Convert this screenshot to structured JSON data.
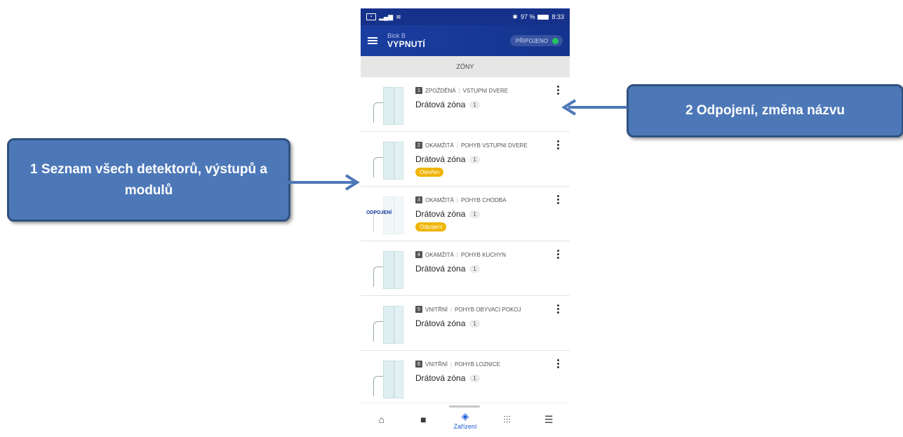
{
  "statusbar": {
    "left": "… ≡",
    "right": "97 %",
    "time": "8:33"
  },
  "appbar": {
    "subtitle": "Blok B",
    "title": "VYPNUTÍ",
    "connection": "PŘIPOJENO"
  },
  "section_title": "ZÓNY",
  "zones": [
    {
      "num": "1",
      "type": "ZPOŽDĚNÁ",
      "name": "VSTUPNI DVERE",
      "label": "Drátová zóna",
      "count": "1",
      "state": ""
    },
    {
      "num": "2",
      "type": "OKAMŽITÁ",
      "name": "POHYB VSTUPNI DVERE",
      "label": "Drátová zóna",
      "count": "1",
      "state": "Otevřen"
    },
    {
      "num": "3",
      "type": "OKAMŽITÁ",
      "name": "POHYB CHODBA",
      "label": "Drátová zóna",
      "count": "1",
      "state": "Odpojení",
      "overlay": "ODPOJENÍ"
    },
    {
      "num": "4",
      "type": "OKAMŽITÁ",
      "name": "POHYB KUCHYN",
      "label": "Drátová zóna",
      "count": "1",
      "state": ""
    },
    {
      "num": "5",
      "type": "VNITŘNÍ",
      "name": "POHYB OBYVACI POKOJ",
      "label": "Drátová zóna",
      "count": "1",
      "state": ""
    },
    {
      "num": "6",
      "type": "VNITŘNÍ",
      "name": "POHYB LOZNICE",
      "label": "Drátová zóna",
      "count": "1",
      "state": ""
    }
  ],
  "bottom_nav": {
    "active_label": "Zařízení"
  },
  "callouts": {
    "one": "1 Seznam všech detektorů, výstupů a modulů",
    "two": "2 Odpojení, změna názvu"
  },
  "colors": {
    "header": "#1a3ea0",
    "callout_fill": "#4d78b8",
    "callout_border": "#2f527f",
    "state_badge": "#f0b400",
    "connected": "#22c55e"
  }
}
